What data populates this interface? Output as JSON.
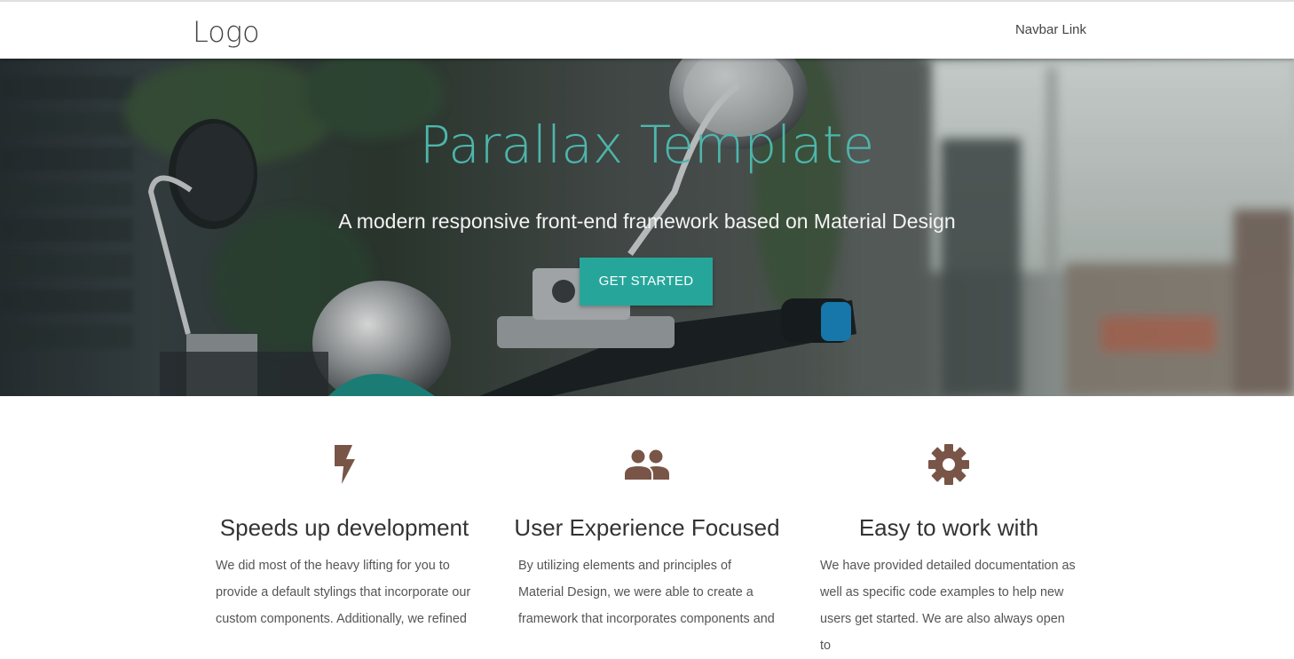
{
  "navbar": {
    "logo": "Logo",
    "link": "Navbar Link"
  },
  "hero": {
    "title": "Parallax Template",
    "subtitle": "A modern responsive front-end framework based on Material Design",
    "button": "GET STARTED"
  },
  "features": [
    {
      "icon": "flash-icon",
      "title": "Speeds up development",
      "text": "We did most of the heavy lifting for you to provide a default stylings that incorporate our custom components. Additionally, we refined"
    },
    {
      "icon": "group-icon",
      "title": "User Experience Focused",
      "text": "By utilizing elements and principles of Material Design, we were able to create a framework that incorporates components and"
    },
    {
      "icon": "settings-icon",
      "title": "Easy to work with",
      "text": "We have provided detailed documentation as well as specific code examples to help new users get started. We are also always open to"
    }
  ],
  "colors": {
    "accent": "#26a69a",
    "title": "#4db6ac",
    "icon": "#795548"
  }
}
